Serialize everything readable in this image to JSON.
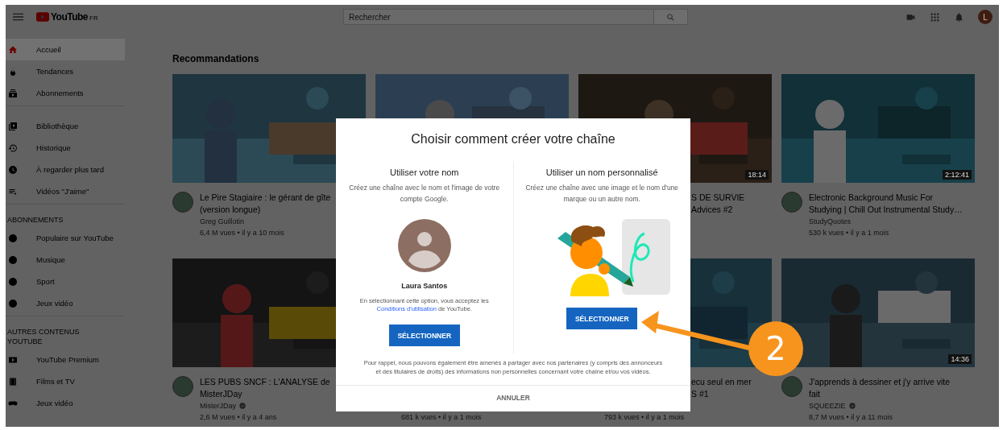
{
  "header": {
    "logo": "YouTube",
    "region": "FR",
    "search": {
      "placeholder": "Rechercher"
    },
    "avatar": "L"
  },
  "sidebar": {
    "sections": [
      {
        "items": [
          {
            "label": "Accueil",
            "selected": true
          },
          {
            "label": "Tendances",
            "selected": false
          },
          {
            "label": "Abonnements",
            "selected": false
          }
        ]
      },
      {
        "items": [
          {
            "label": "Bibliothèque",
            "selected": false
          },
          {
            "label": "Historique",
            "selected": false
          },
          {
            "label": "À regarder plus tard",
            "selected": false
          },
          {
            "label": "Vidéos \"J'aime\"",
            "selected": false
          }
        ]
      },
      {
        "title": "ABONNEMENTS",
        "items": [
          {
            "label": "Populaire sur YouTube",
            "selected": false
          },
          {
            "label": "Musique",
            "selected": false
          },
          {
            "label": "Sport",
            "selected": false
          },
          {
            "label": "Jeux vidéo",
            "selected": false
          }
        ]
      },
      {
        "title": "AUTRES CONTENUS YOUTUBE",
        "items": [
          {
            "label": "YouTube Premium",
            "selected": false
          },
          {
            "label": "Films et TV",
            "selected": false
          },
          {
            "label": "Jeux vidéo",
            "selected": false
          }
        ]
      }
    ]
  },
  "feed": {
    "title": "Recommandations",
    "videos": [
      {
        "kind": "full",
        "title": [
          "Le Pire Stagiaire : le gérant de gîte",
          "(version longue)"
        ],
        "channel": "Greg Guillotin",
        "verified": false,
        "meta": "6,4 M vues • il y a 10 mois"
      },
      {
        "kind": "hidden"
      },
      {
        "kind": "covered",
        "title": [
          "S DE SURVIE",
          "Advices #2"
        ],
        "duration": "18:14"
      },
      {
        "kind": "full",
        "title": [
          "Electronic Background Music For",
          "Studying | Chill Out Instrumental Study…"
        ],
        "channel": "StudyQuotes",
        "verified": false,
        "meta": "530 k vues • il y a 1 mois",
        "duration": "2:12:41"
      },
      {
        "kind": "full",
        "title": [
          "LES PUBS SNCF : L'ANALYSE de",
          "MisterJDay"
        ],
        "channel": "MisterJDay",
        "verified": true,
        "meta": "2,6 M vues • il y a 4 ans"
      },
      {
        "kind": "meta-only",
        "meta": "681 k vues • il y a 1 mois"
      },
      {
        "kind": "covered",
        "title": [
          "ecu seul en mer",
          "S #1"
        ],
        "meta": "793 k vues • il y a 1 mois"
      },
      {
        "kind": "full",
        "title": [
          "J'apprends à dessiner et j'y arrive vite",
          "fait"
        ],
        "channel": "SQUEEZIE",
        "verified": true,
        "meta": "8,7 M vues • il y a 11 mois",
        "duration": "14:36"
      }
    ]
  },
  "dialog": {
    "title": "Choisir comment créer votre chaîne",
    "options": [
      {
        "kind": "account",
        "heading": "Utiliser votre nom",
        "description": "Créez une chaîne avec le nom et l'image de votre compte Google.",
        "name": "Laura Santos",
        "terms": "En sélectionnant cette option, vous acceptez les",
        "terms_link": "Conditions d'utilisation",
        "terms_end": "de YouTube.",
        "button": "SÉLECTIONNER"
      },
      {
        "kind": "custom",
        "heading": "Utiliser un nom personnalisé",
        "description": "Créez une chaîne avec une image et le nom d'une marque ou un autre nom.",
        "button": "SÉLECTIONNER"
      }
    ],
    "note": "Pour rappel, nous pouvons également être amenés à partager avec nos partenaires (y compris des annonceurs et des titulaires de droits) des informations non personnelles concernant votre chaîne et/ou vos vidéos.",
    "cancel": "ANNULER"
  },
  "callout": {
    "number": "2"
  }
}
